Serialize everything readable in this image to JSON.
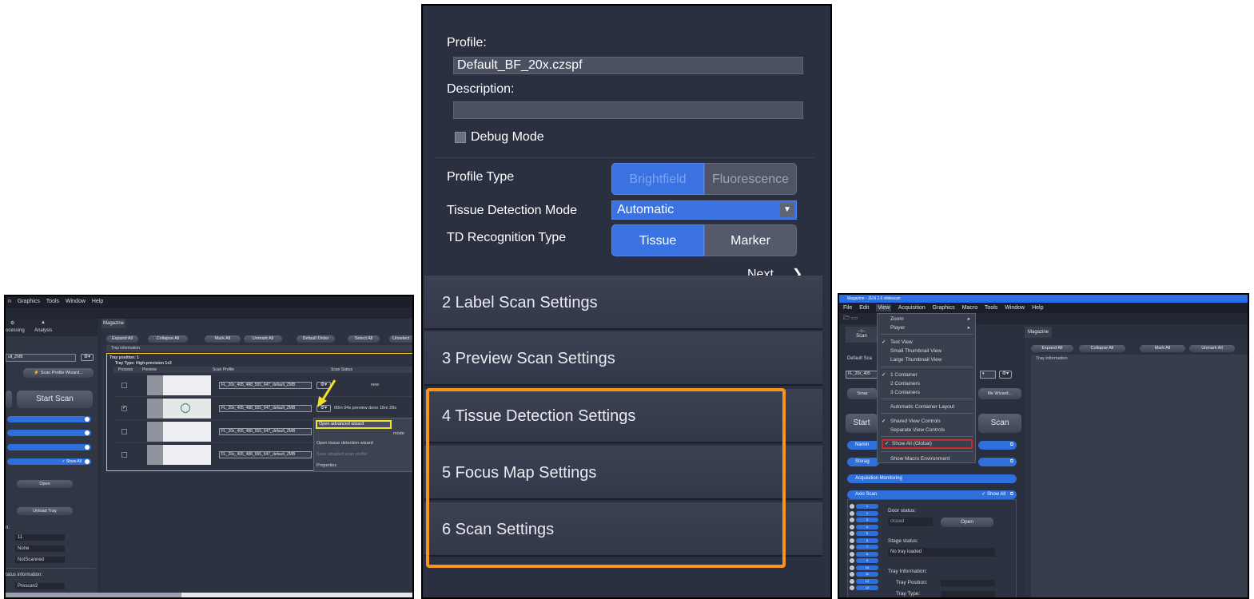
{
  "left": {
    "menu": [
      "n",
      "Graphics",
      "Tools",
      "Window",
      "Help"
    ],
    "sidebar_tabs": [
      "ocessing",
      "Analysis"
    ],
    "profile_select": "ult_ZMB",
    "scan_profile_wizard": "Scan Profile Wizard...",
    "start_scan": "Start Scan",
    "show_all": "✓ Show All",
    "open": "Open",
    "unload_tray": "Unload Tray",
    "field_label": "n:",
    "fields": [
      "11",
      "None",
      "NotScanned"
    ],
    "status_info": "tatus information:",
    "prescan": "Prescan2",
    "magazine_tab": "Magazine",
    "toolbar": [
      "Expand All",
      "Collapse All",
      "Mark All",
      "Unmark All",
      "Default Order",
      "Select All",
      "Unselect"
    ],
    "tray_information": "Tray information",
    "tray_position": "Tray position:  1",
    "tray_type": "Tray Type:  High-precision 1x3",
    "columns": [
      "Process",
      "Preview",
      "Scan Profile",
      "Scan Status"
    ],
    "rows": [
      {
        "profile": "FL_20x_405_488_555_647_default_ZMB",
        "status": "new",
        "checked": false
      },
      {
        "profile": "FL_20x_405_488_555_647_default_ZMB",
        "status": "00m 04s    preview done    16m 28s",
        "checked": true
      },
      {
        "profile": "FL_20x_405_488_555_647_default_ZMB",
        "status": "",
        "checked": false
      },
      {
        "profile": "FL_20x_405_488_555_647_default_ZMB",
        "status": "",
        "checked": false
      }
    ],
    "context_menu": [
      "Open advanced wizard",
      "mode",
      "Open tissue detection wizard",
      "Save adapted scan profile",
      "Properties"
    ]
  },
  "middle": {
    "profile_label": "Profile:",
    "profile_value": "Default_BF_20x.czspf",
    "description_label": "Description:",
    "description_value": "",
    "debug_mode": "Debug Mode",
    "profile_type_label": "Profile Type",
    "profile_type_options": [
      "Brightfield",
      "Fluorescence"
    ],
    "tissue_detection_mode_label": "Tissue Detection Mode",
    "tissue_detection_mode_value": "Automatic",
    "td_recognition_label": "TD Recognition Type",
    "td_recognition_options": [
      "Tissue",
      "Marker"
    ],
    "next": "Next",
    "sections": [
      "2  Label Scan Settings",
      "3  Preview Scan Settings",
      "4  Tissue Detection Settings",
      "5  Focus Map Settings",
      "6  Scan Settings"
    ],
    "highlight_color": "#f7941d"
  },
  "right": {
    "title": "Magazine - ZEN 2.6 slidescan",
    "menu": [
      "File",
      "Edit",
      "View",
      "Acquisition",
      "Graphics",
      "Macro",
      "Tools",
      "Window",
      "Help"
    ],
    "scan_tab": "Scan",
    "magazine_tab": "Magazine",
    "toolbar": [
      "Expand All",
      "Collapse All",
      "Mark All",
      "Unmark All"
    ],
    "tray_information": "Tray information",
    "default_scan": "Default Sca",
    "profile_select": "FL_20x_405",
    "smart": "Smar",
    "wizard": "file Wizard...",
    "start": "Start",
    "scan": "Scan",
    "bars": [
      "Namin",
      "Storag",
      "Acquisition Monitoring",
      "Axio Scan"
    ],
    "show_all": "✓ Show All",
    "view_menu": [
      "Zoom",
      "Player",
      "Text View",
      "Small Thumbnail View",
      "Large Thumbnail View",
      "1 Container",
      "2 Containers",
      "3 Containers",
      "Automatic Container Layout",
      "Shared View Controls",
      "Separate View Controls",
      "Show All (Global)",
      "Show Macro Environment"
    ],
    "door_status_label": "Door status:",
    "door_status": "closed",
    "open": "Open",
    "stage_status_label": "Stage status:",
    "stage_status": "No tray loaded",
    "tray_information_label": "Tray Information:",
    "tray_position_label": "Tray Position:",
    "tray_type_label": "Tray Type:",
    "tray_numbers": [
      "1",
      "2",
      "3",
      "4",
      "5",
      "6",
      "7",
      "8",
      "9",
      "10",
      "11",
      "12",
      "13"
    ]
  }
}
